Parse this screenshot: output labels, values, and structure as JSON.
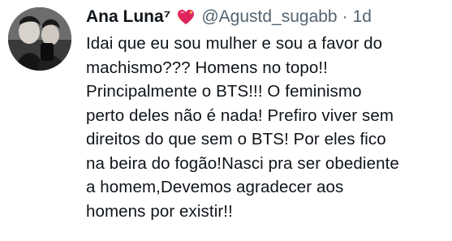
{
  "tweet": {
    "display_name": "Ana Luna⁷",
    "badge_icon": "sparkling-heart-icon",
    "handle": "@Agustd_sugabb",
    "separator": "·",
    "time": "1d",
    "text_lines": [
      "Idai que eu sou mulher e sou a favor do",
      "machismo??? Homens no topo!!",
      "Principalmente o BTS!!! O feminismo",
      "perto deles não é nada! Prefiro viver sem",
      "direitos do que sem o BTS! Por eles fico",
      "na beira do fogão!Nasci pra ser obediente",
      "a homem,Devemos agradecer aos",
      "homens por existir!!"
    ]
  },
  "colors": {
    "text_primary": "#0f1419",
    "text_secondary": "#536471",
    "heart": "#e0245e"
  }
}
